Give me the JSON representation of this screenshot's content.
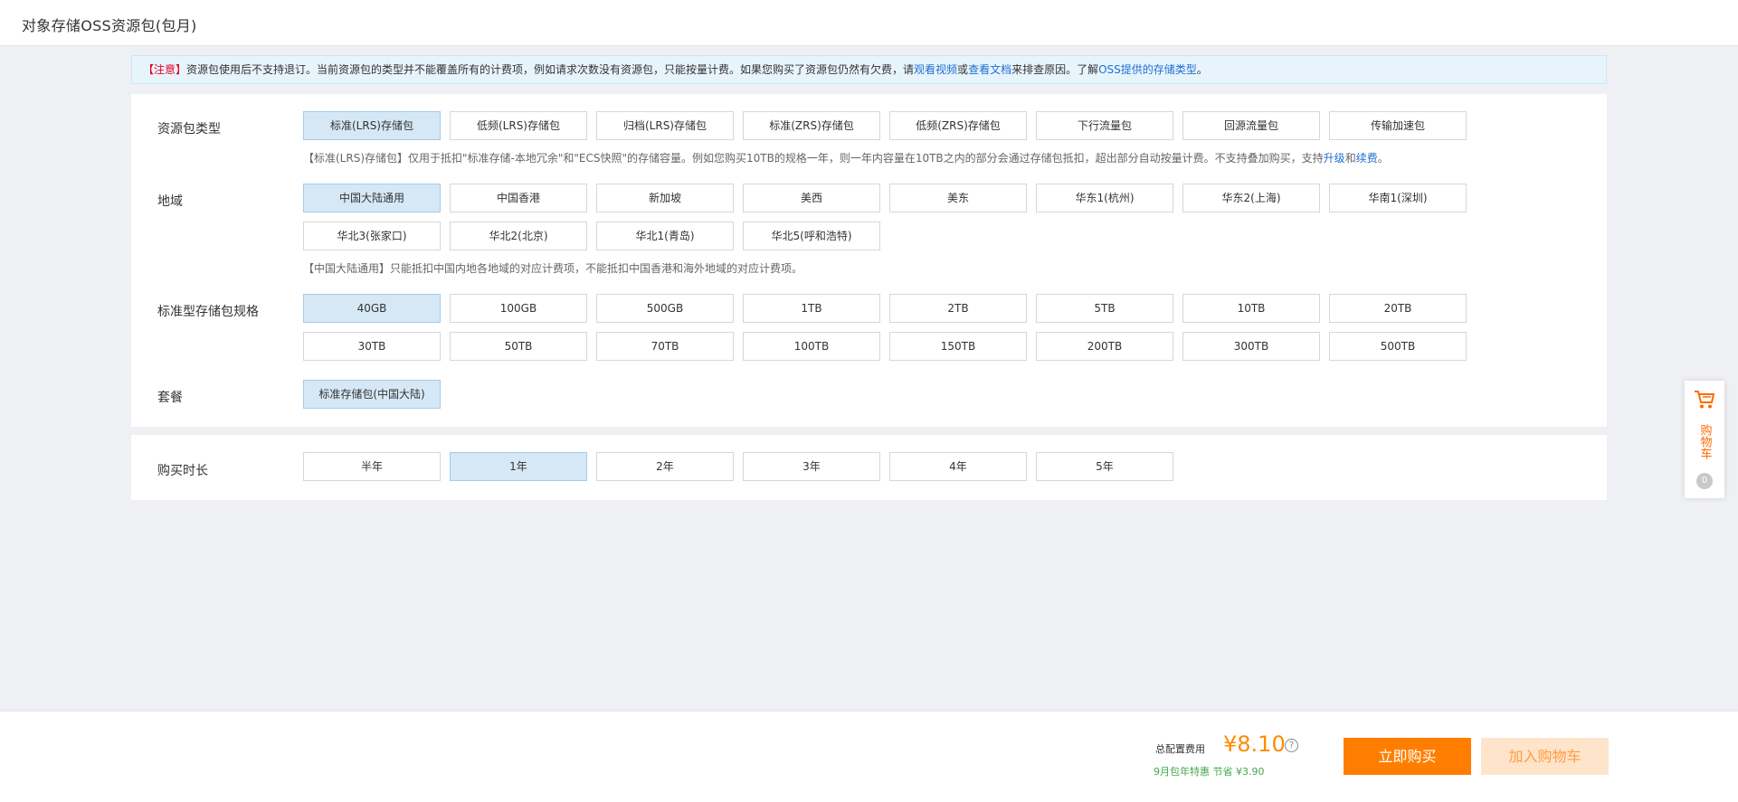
{
  "header": {
    "title": "对象存储OSS资源包(包月)"
  },
  "notice": {
    "warn": "【注意】",
    "text1": "资源包使用后不支持退订。当前资源包的类型并不能覆盖所有的计费项，例如请求次数没有资源包，只能按量计费。如果您购买了资源包仍然有欠费，请",
    "link_video": "观看视频",
    "or": "或",
    "link_doc": "查看文档",
    "text2": "来排查原因。了解",
    "link_types": "OSS提供的存储类型",
    "end": "。"
  },
  "package_type": {
    "label": "资源包类型",
    "options": [
      "标准(LRS)存储包",
      "低频(LRS)存储包",
      "归档(LRS)存储包",
      "标准(ZRS)存储包",
      "低频(ZRS)存储包",
      "下行流量包",
      "回源流量包",
      "传输加速包"
    ],
    "selected": 0,
    "hint_text": "【标准(LRS)存储包】仅用于抵扣\"标准存储-本地冗余\"和\"ECS快照\"的存储容量。例如您购买10TB的规格一年，则一年内容量在10TB之内的部分会通过存储包抵扣，超出部分自动按量计费。不支持叠加购买，支持",
    "hint_upgrade": "升级",
    "hint_and": "和",
    "hint_renew": "续费",
    "hint_end": "。"
  },
  "region": {
    "label": "地域",
    "options": [
      "中国大陆通用",
      "中国香港",
      "新加坡",
      "美西",
      "美东",
      "华东1(杭州)",
      "华东2(上海)",
      "华南1(深圳)",
      "华北3(张家口)",
      "华北2(北京)",
      "华北1(青岛)",
      "华北5(呼和浩特)"
    ],
    "selected": 0,
    "hint": "【中国大陆通用】只能抵扣中国内地各地域的对应计费项，不能抵扣中国香港和海外地域的对应计费项。"
  },
  "spec": {
    "label": "标准型存储包规格",
    "options": [
      "40GB",
      "100GB",
      "500GB",
      "1TB",
      "2TB",
      "5TB",
      "10TB",
      "20TB",
      "30TB",
      "50TB",
      "70TB",
      "100TB",
      "150TB",
      "200TB",
      "300TB",
      "500TB"
    ],
    "selected": 0
  },
  "plan": {
    "label": "套餐",
    "options": [
      "标准存储包(中国大陆)"
    ],
    "selected": 0
  },
  "duration": {
    "label": "购买时长",
    "options": [
      "半年",
      "1年",
      "2年",
      "3年",
      "4年",
      "5年"
    ],
    "selected": 1
  },
  "cart_float": {
    "label": "购物车",
    "count": "0"
  },
  "footer": {
    "total_label": "总配置费用",
    "price": "¥8.10",
    "help": "?",
    "promo": "9月包年特惠 节省 ¥3.90",
    "buy_now": "立即购买",
    "add_cart": "加入购物车"
  },
  "colors": {
    "accent": "#ff7e00",
    "price": "#ff8a00",
    "selected_bg": "#d6e8f6",
    "link": "#1f6fd1",
    "promo": "#44a84b",
    "notice_bg": "#e8f4fc"
  }
}
